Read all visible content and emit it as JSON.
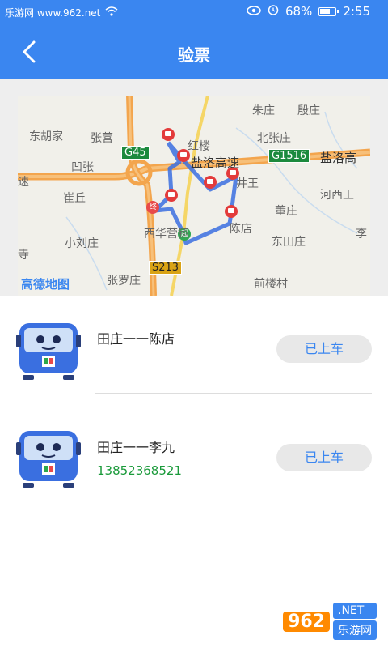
{
  "status_bar": {
    "watermark_text": "乐游网 www.962.net",
    "battery": "68%",
    "time": "2:55"
  },
  "header": {
    "title": "验票"
  },
  "map": {
    "labels": [
      "朱庄",
      "殷庄",
      "东胡家",
      "张营",
      "北张庄",
      "凹张",
      "红楼",
      "井王",
      "河西王",
      "崔丘",
      "董庄",
      "西华营镇",
      "陈店",
      "东田庄",
      "小刘庄",
      "张罗庄",
      "前楼村",
      "李",
      "寺",
      "速"
    ],
    "highway_label": "盐洛高速",
    "highway_label_right": "盐洛高",
    "shields": [
      "G45",
      "G1516",
      "S213"
    ],
    "logo": "高德地图",
    "markers": {
      "start": "起",
      "end": "终"
    }
  },
  "tickets": [
    {
      "route": "田庄一一陈店",
      "phone": "",
      "button": "已上车"
    },
    {
      "route": "田庄一一李九",
      "phone": "13852368521",
      "button": "已上车"
    }
  ],
  "watermark": {
    "brand": "962",
    "suffix": ".NET",
    "text": "乐游网"
  },
  "colors": {
    "primary": "#3a86f0",
    "phone": "#1a9a3a",
    "route_line": "#3b6fe0"
  }
}
